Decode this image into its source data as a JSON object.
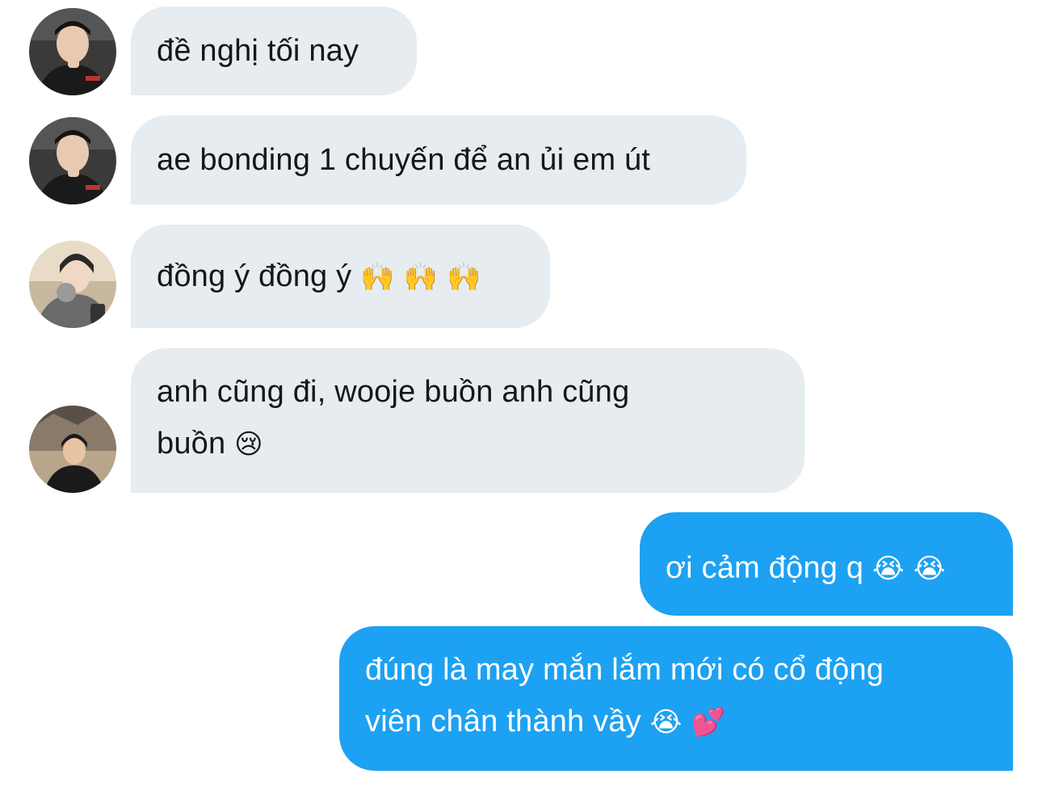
{
  "messages": [
    {
      "sender": "incoming",
      "text": "đề nghị tối nay",
      "emoji": ""
    },
    {
      "sender": "incoming",
      "text": "ae bonding 1 chuyến để an ủi em út",
      "emoji": ""
    },
    {
      "sender": "incoming",
      "text": "đồng ý đồng ý ",
      "emoji": "🙌 🙌 🙌"
    },
    {
      "sender": "incoming",
      "text_line1": "anh cũng đi, wooje buồn anh cũng",
      "text_line2": "buồn ",
      "emoji": "😢"
    },
    {
      "sender": "outgoing",
      "text": "ơi cảm động q ",
      "emoji": "😭 😭"
    },
    {
      "sender": "outgoing",
      "text_line1": "đúng là may mắn lắm mới có cổ động",
      "text_line2": "viên chân thành vầy ",
      "emoji": "😭 💕"
    }
  ],
  "colors": {
    "incoming_bubble": "#e6ecf0",
    "outgoing_bubble": "#1da1f2",
    "incoming_text": "#14171a",
    "outgoing_text": "#ffffff"
  },
  "icons": [
    "avatar-user-1",
    "avatar-user-2",
    "avatar-user-3"
  ]
}
